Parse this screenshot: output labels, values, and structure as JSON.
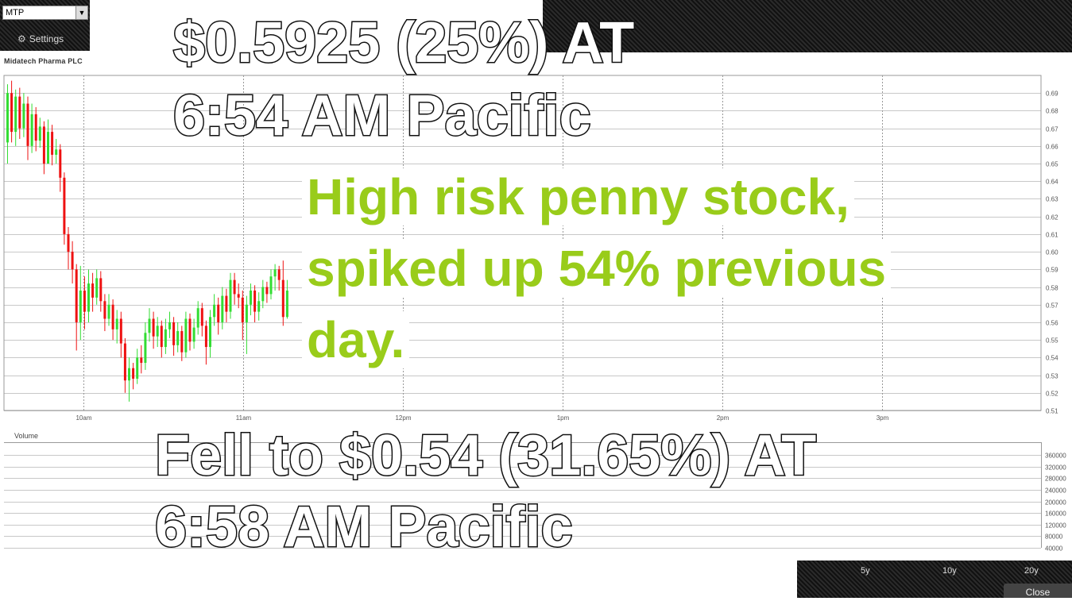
{
  "header": {
    "symbol": "MTP",
    "settings_label": "Settings",
    "company": "Midatech Pharma PLC"
  },
  "overlays": {
    "line1": "$0.5925 (25%) AT",
    "line2": "6:54 AM Pacific",
    "green1": "High risk penny stock,",
    "green2": "spiked up 54% previous",
    "green3": "day.",
    "bottom1": "Fell to $0.54 (31.65%) AT",
    "bottom2": "6:58 AM Pacific"
  },
  "footer": {
    "range_5y": "5y",
    "range_10y": "10y",
    "range_20y": "20y",
    "close_label": "Close"
  },
  "volume_label": "Volume",
  "colors": {
    "up": "#33dd33",
    "down": "#ee1111",
    "green_text": "#99cc1a"
  },
  "chart_data": {
    "type": "candlestick",
    "x_ticks": [
      "10am",
      "11am",
      "12pm",
      "1pm",
      "2pm",
      "3pm"
    ],
    "y_ticks": [
      "0.69",
      "0.68",
      "0.67",
      "0.66",
      "0.65",
      "0.64",
      "0.63",
      "0.62",
      "0.61",
      "0.60",
      "0.59",
      "0.58",
      "0.57",
      "0.56",
      "0.55",
      "0.54",
      "0.53",
      "0.52",
      "0.51"
    ],
    "ylim": [
      0.51,
      0.7
    ],
    "volume_ticks": [
      "360000",
      "320000",
      "280000",
      "240000",
      "200000",
      "160000",
      "120000",
      "80000",
      "40000"
    ],
    "candles": [
      {
        "o": 0.662,
        "c": 0.69,
        "h": 0.695,
        "l": 0.65
      },
      {
        "o": 0.69,
        "c": 0.668,
        "h": 0.697,
        "l": 0.662
      },
      {
        "o": 0.668,
        "c": 0.688,
        "h": 0.692,
        "l": 0.66
      },
      {
        "o": 0.688,
        "c": 0.67,
        "h": 0.693,
        "l": 0.664
      },
      {
        "o": 0.67,
        "c": 0.684,
        "h": 0.69,
        "l": 0.665
      },
      {
        "o": 0.684,
        "c": 0.66,
        "h": 0.688,
        "l": 0.652
      },
      {
        "o": 0.66,
        "c": 0.678,
        "h": 0.684,
        "l": 0.656
      },
      {
        "o": 0.678,
        "c": 0.663,
        "h": 0.682,
        "l": 0.657
      },
      {
        "o": 0.663,
        "c": 0.671,
        "h": 0.676,
        "l": 0.659
      },
      {
        "o": 0.671,
        "c": 0.65,
        "h": 0.674,
        "l": 0.644
      },
      {
        "o": 0.65,
        "c": 0.668,
        "h": 0.675,
        "l": 0.65
      },
      {
        "o": 0.668,
        "c": 0.655,
        "h": 0.672,
        "l": 0.649
      },
      {
        "o": 0.655,
        "c": 0.658,
        "h": 0.664,
        "l": 0.65
      },
      {
        "o": 0.658,
        "c": 0.642,
        "h": 0.661,
        "l": 0.634
      },
      {
        "o": 0.642,
        "c": 0.61,
        "h": 0.645,
        "l": 0.604
      },
      {
        "o": 0.61,
        "c": 0.6,
        "h": 0.614,
        "l": 0.59
      },
      {
        "o": 0.6,
        "c": 0.59,
        "h": 0.606,
        "l": 0.582
      },
      {
        "o": 0.59,
        "c": 0.56,
        "h": 0.593,
        "l": 0.544
      },
      {
        "o": 0.56,
        "c": 0.578,
        "h": 0.592,
        "l": 0.55
      },
      {
        "o": 0.578,
        "c": 0.566,
        "h": 0.586,
        "l": 0.556
      },
      {
        "o": 0.566,
        "c": 0.582,
        "h": 0.59,
        "l": 0.56
      },
      {
        "o": 0.582,
        "c": 0.574,
        "h": 0.588,
        "l": 0.566
      },
      {
        "o": 0.574,
        "c": 0.585,
        "h": 0.59,
        "l": 0.57
      },
      {
        "o": 0.585,
        "c": 0.572,
        "h": 0.589,
        "l": 0.566
      },
      {
        "o": 0.572,
        "c": 0.562,
        "h": 0.576,
        "l": 0.555
      },
      {
        "o": 0.562,
        "c": 0.57,
        "h": 0.576,
        "l": 0.558
      },
      {
        "o": 0.57,
        "c": 0.556,
        "h": 0.573,
        "l": 0.55
      },
      {
        "o": 0.556,
        "c": 0.562,
        "h": 0.567,
        "l": 0.548
      },
      {
        "o": 0.562,
        "c": 0.548,
        "h": 0.566,
        "l": 0.54
      },
      {
        "o": 0.548,
        "c": 0.527,
        "h": 0.551,
        "l": 0.52
      },
      {
        "o": 0.527,
        "c": 0.534,
        "h": 0.54,
        "l": 0.515
      },
      {
        "o": 0.534,
        "c": 0.528,
        "h": 0.537,
        "l": 0.522
      },
      {
        "o": 0.528,
        "c": 0.54,
        "h": 0.545,
        "l": 0.525
      },
      {
        "o": 0.54,
        "c": 0.537,
        "h": 0.547,
        "l": 0.531
      },
      {
        "o": 0.537,
        "c": 0.554,
        "h": 0.56,
        "l": 0.533
      },
      {
        "o": 0.554,
        "c": 0.562,
        "h": 0.568,
        "l": 0.549
      },
      {
        "o": 0.562,
        "c": 0.552,
        "h": 0.566,
        "l": 0.545
      },
      {
        "o": 0.552,
        "c": 0.558,
        "h": 0.563,
        "l": 0.546
      },
      {
        "o": 0.558,
        "c": 0.546,
        "h": 0.561,
        "l": 0.54
      },
      {
        "o": 0.546,
        "c": 0.556,
        "h": 0.562,
        "l": 0.542
      },
      {
        "o": 0.556,
        "c": 0.56,
        "h": 0.566,
        "l": 0.551
      },
      {
        "o": 0.56,
        "c": 0.547,
        "h": 0.563,
        "l": 0.541
      },
      {
        "o": 0.547,
        "c": 0.555,
        "h": 0.56,
        "l": 0.543
      },
      {
        "o": 0.555,
        "c": 0.543,
        "h": 0.558,
        "l": 0.538
      },
      {
        "o": 0.543,
        "c": 0.562,
        "h": 0.566,
        "l": 0.54
      },
      {
        "o": 0.562,
        "c": 0.549,
        "h": 0.565,
        "l": 0.544
      },
      {
        "o": 0.549,
        "c": 0.557,
        "h": 0.562,
        "l": 0.545
      },
      {
        "o": 0.557,
        "c": 0.568,
        "h": 0.572,
        "l": 0.553
      },
      {
        "o": 0.568,
        "c": 0.558,
        "h": 0.571,
        "l": 0.552
      },
      {
        "o": 0.558,
        "c": 0.546,
        "h": 0.561,
        "l": 0.536
      },
      {
        "o": 0.546,
        "c": 0.563,
        "h": 0.567,
        "l": 0.54
      },
      {
        "o": 0.563,
        "c": 0.57,
        "h": 0.576,
        "l": 0.558
      },
      {
        "o": 0.57,
        "c": 0.56,
        "h": 0.574,
        "l": 0.553
      },
      {
        "o": 0.56,
        "c": 0.575,
        "h": 0.58,
        "l": 0.556
      },
      {
        "o": 0.575,
        "c": 0.566,
        "h": 0.579,
        "l": 0.56
      },
      {
        "o": 0.566,
        "c": 0.584,
        "h": 0.588,
        "l": 0.562
      },
      {
        "o": 0.584,
        "c": 0.576,
        "h": 0.588,
        "l": 0.57
      },
      {
        "o": 0.576,
        "c": 0.574,
        "h": 0.582,
        "l": 0.568
      },
      {
        "o": 0.574,
        "c": 0.56,
        "h": 0.578,
        "l": 0.55
      },
      {
        "o": 0.56,
        "c": 0.57,
        "h": 0.575,
        "l": 0.542
      },
      {
        "o": 0.57,
        "c": 0.578,
        "h": 0.582,
        "l": 0.564
      },
      {
        "o": 0.578,
        "c": 0.566,
        "h": 0.581,
        "l": 0.56
      },
      {
        "o": 0.566,
        "c": 0.572,
        "h": 0.577,
        "l": 0.561
      },
      {
        "o": 0.572,
        "c": 0.58,
        "h": 0.584,
        "l": 0.568
      },
      {
        "o": 0.58,
        "c": 0.576,
        "h": 0.583,
        "l": 0.571
      },
      {
        "o": 0.576,
        "c": 0.586,
        "h": 0.59,
        "l": 0.573
      },
      {
        "o": 0.586,
        "c": 0.59,
        "h": 0.593,
        "l": 0.578
      },
      {
        "o": 0.59,
        "c": 0.584,
        "h": 0.592,
        "l": 0.578
      },
      {
        "o": 0.584,
        "c": 0.563,
        "h": 0.595,
        "l": 0.558
      },
      {
        "o": 0.563,
        "c": 0.578,
        "h": 0.584,
        "l": 0.562
      }
    ]
  }
}
